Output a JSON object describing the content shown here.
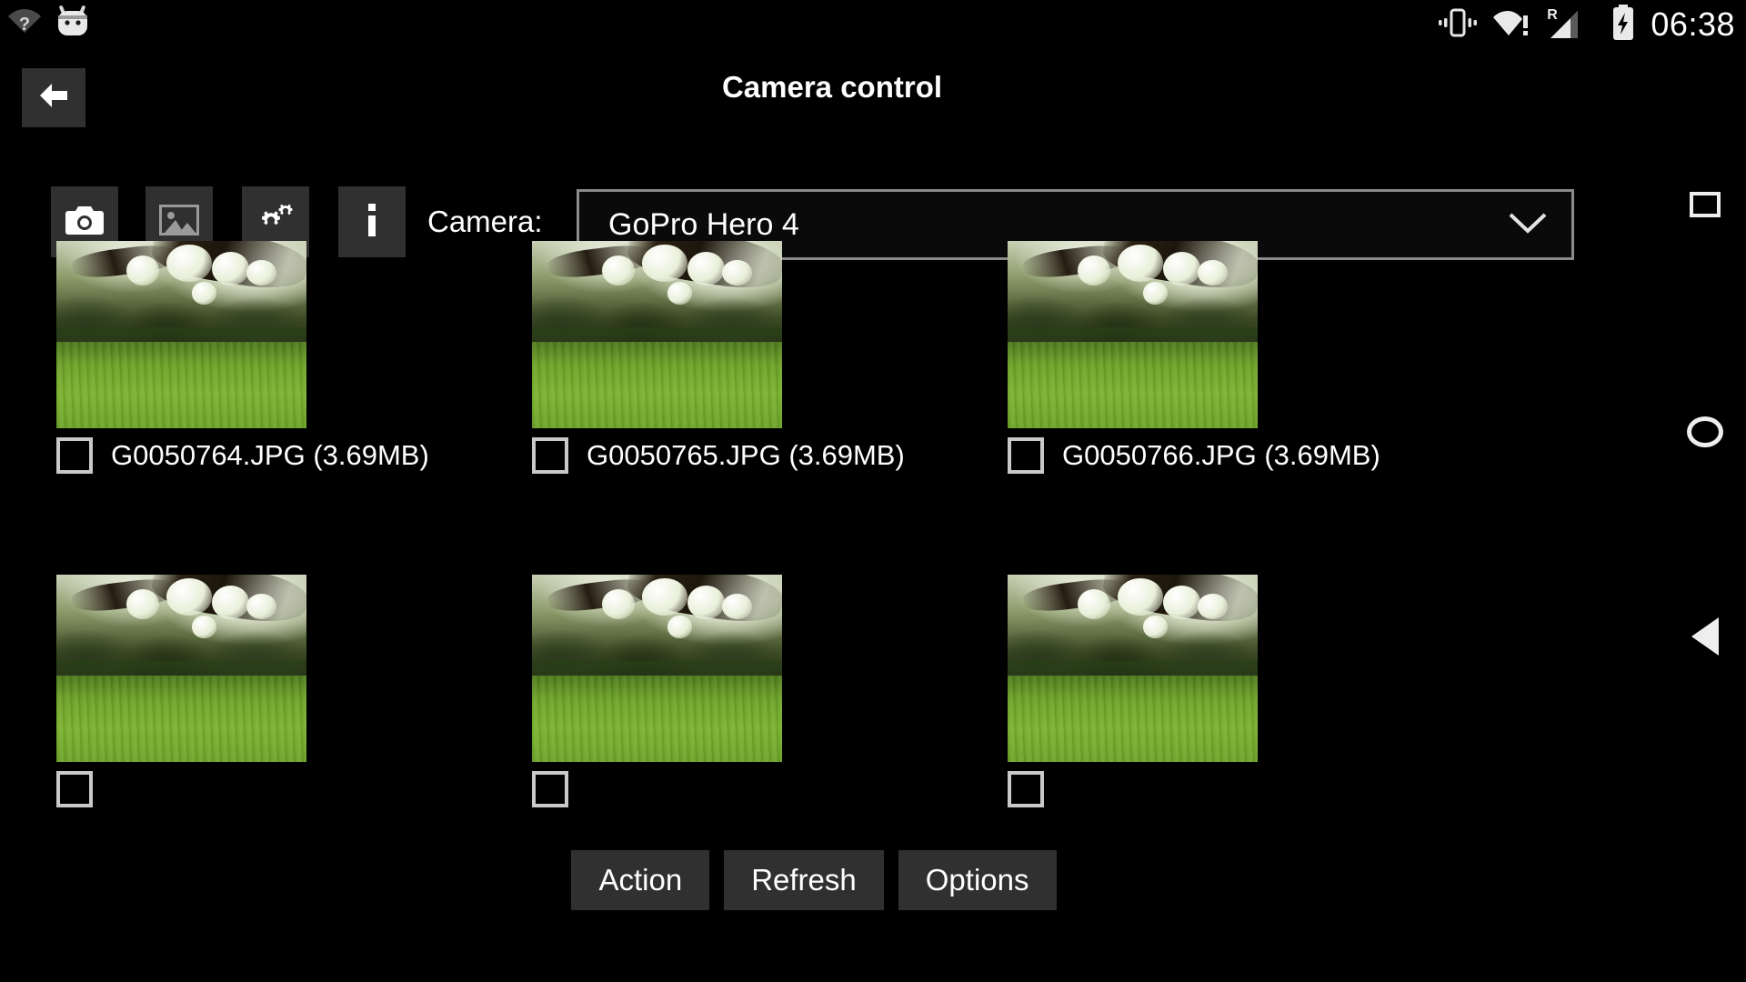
{
  "status_bar": {
    "left_icons": [
      "wifi-question-icon",
      "android-mascot-icon"
    ],
    "right_icons": [
      "vibrate-icon",
      "wifi-alert-icon",
      "roaming-signal-icon",
      "battery-charging-icon"
    ],
    "roaming_label": "R",
    "time": "06:38"
  },
  "action_bar": {
    "back_icon": "arrow-left-icon",
    "title": "Camera control"
  },
  "toolbar": {
    "buttons": [
      {
        "icon": "camera-icon",
        "name": "capture-button"
      },
      {
        "icon": "gallery-icon",
        "name": "gallery-button"
      },
      {
        "icon": "gears-icon",
        "name": "settings-button"
      },
      {
        "icon": "info-icon",
        "name": "info-button"
      }
    ],
    "camera_label": "Camera:",
    "camera_value": "GoPro Hero 4",
    "dropdown_icon": "chevron-down-icon"
  },
  "files": [
    {
      "name": "G0050764.JPG (3.69MB)",
      "checked": false
    },
    {
      "name": "G0050765.JPG (3.69MB)",
      "checked": false
    },
    {
      "name": "G0050766.JPG (3.69MB)",
      "checked": false
    },
    {
      "name": "",
      "checked": false
    },
    {
      "name": "",
      "checked": false
    },
    {
      "name": "",
      "checked": false
    }
  ],
  "bottom_buttons": [
    {
      "label": "Action"
    },
    {
      "label": "Refresh"
    },
    {
      "label": "Options"
    }
  ],
  "nav_bar": {
    "recents_icon": "square-recents-icon",
    "home_icon": "circle-home-icon",
    "back_icon": "triangle-back-icon"
  },
  "colors": {
    "background": "#000000",
    "button_surface": "#303030",
    "text": "#ffffff",
    "outline": "#8a8a8a"
  }
}
